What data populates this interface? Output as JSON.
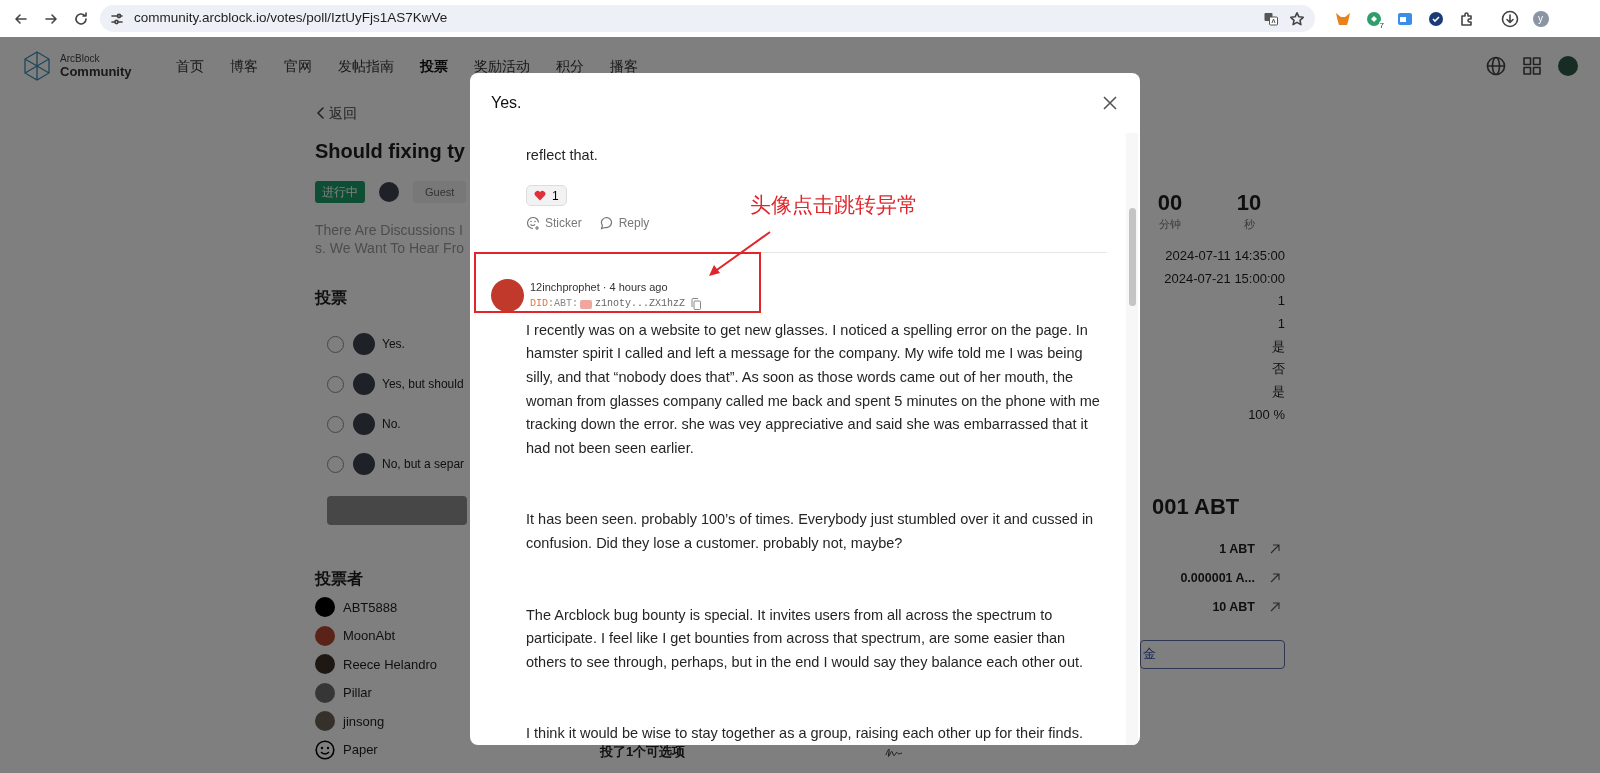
{
  "browser": {
    "url": "community.arcblock.io/votes/poll/IztUyFjs1AS7KwVe",
    "extension_badge": "7",
    "profile_initial": "y"
  },
  "site": {
    "logo": {
      "line1": "ArcBlock",
      "line2": "Community"
    },
    "nav": [
      {
        "label": "首页",
        "selected": false
      },
      {
        "label": "博客",
        "selected": false
      },
      {
        "label": "官网",
        "selected": false
      },
      {
        "label": "发帖指南",
        "selected": false
      },
      {
        "label": "投票",
        "selected": true
      },
      {
        "label": "奖励活动",
        "selected": false
      },
      {
        "label": "积分",
        "selected": false
      },
      {
        "label": "播客",
        "selected": false
      }
    ]
  },
  "poll": {
    "back": "返回",
    "title": "Should fixing ty",
    "status": "进行中",
    "author_role": "Guest",
    "description": [
      "There Are Discussions I",
      "s. We Want To Hear Fro"
    ],
    "options_title": "投票",
    "options": [
      {
        "label": "Yes.",
        "selected": false
      },
      {
        "label": "Yes, but should",
        "selected": false
      },
      {
        "label": "No.",
        "selected": false
      },
      {
        "label": "No, but a separ",
        "selected": false
      }
    ],
    "voters_title": "投票者",
    "voters": [
      {
        "name": "ABT5888",
        "kind": "photo"
      },
      {
        "name": "MoonAbt",
        "kind": "photo"
      },
      {
        "name": "Reece Helandro",
        "kind": "photo"
      },
      {
        "name": "Pillar",
        "kind": "photo"
      },
      {
        "name": "jinsong",
        "kind": "photo"
      },
      {
        "name": "Paper",
        "kind": "smiley"
      }
    ],
    "vote_summary": "投了1个可选项"
  },
  "countdown": [
    {
      "value": "00",
      "unit": "分钟"
    },
    {
      "value": "10",
      "unit": "秒"
    }
  ],
  "details": [
    "2024-07-11 14:35:00",
    "2024-07-21 15:00:00",
    "1",
    "1",
    "是",
    "否",
    "是",
    "100 %"
  ],
  "rewards": {
    "total": "001 ABT",
    "rows": [
      {
        "amount": "1 ABT"
      },
      {
        "amount": "0.000001 A..."
      },
      {
        "amount": "10 ABT"
      }
    ],
    "button": "金"
  },
  "modal": {
    "title": "Yes.",
    "previous_tail": "reflect that.",
    "reaction_count": "1",
    "actions": [
      {
        "kind": "sticker",
        "label": "Sticker"
      },
      {
        "kind": "reply",
        "label": "Reply"
      }
    ],
    "comment": {
      "byline": "12inchprophet · 4 hours ago",
      "did_method": "DID",
      "did_type": ":ABT:",
      "did_short": "z1noty...ZX1hzZ",
      "paragraphs": [
        "I recently was on a website to get new glasses. I noticed a spelling error on the page. In hamster spirit I called and left a message for the company. My wife told me I was being silly, and that “nobody does that”.  As soon as those words came out of her mouth, the woman from glasses company called me back and spent 5 minutes on the phone with me tracking down the error. she was vey appreciative and said she was embarrassed that it had not been seen earlier.",
        "It has been seen. probably 100’s of times.  Everybody just stumbled over it and cussed in confusion. Did they lose a customer. probably not, maybe?",
        "The Arcblock bug bounty is special. It invites users from all across the spectrum to participate.  I feel like I get bounties from across that spectrum, are some easier than others to see through, perhaps, but in the end I would say they balance each other out.",
        "I think it would be wise to stay together as a group, raising each other up for their finds."
      ]
    }
  },
  "annotation": {
    "text": "头像点击跳转异常"
  }
}
